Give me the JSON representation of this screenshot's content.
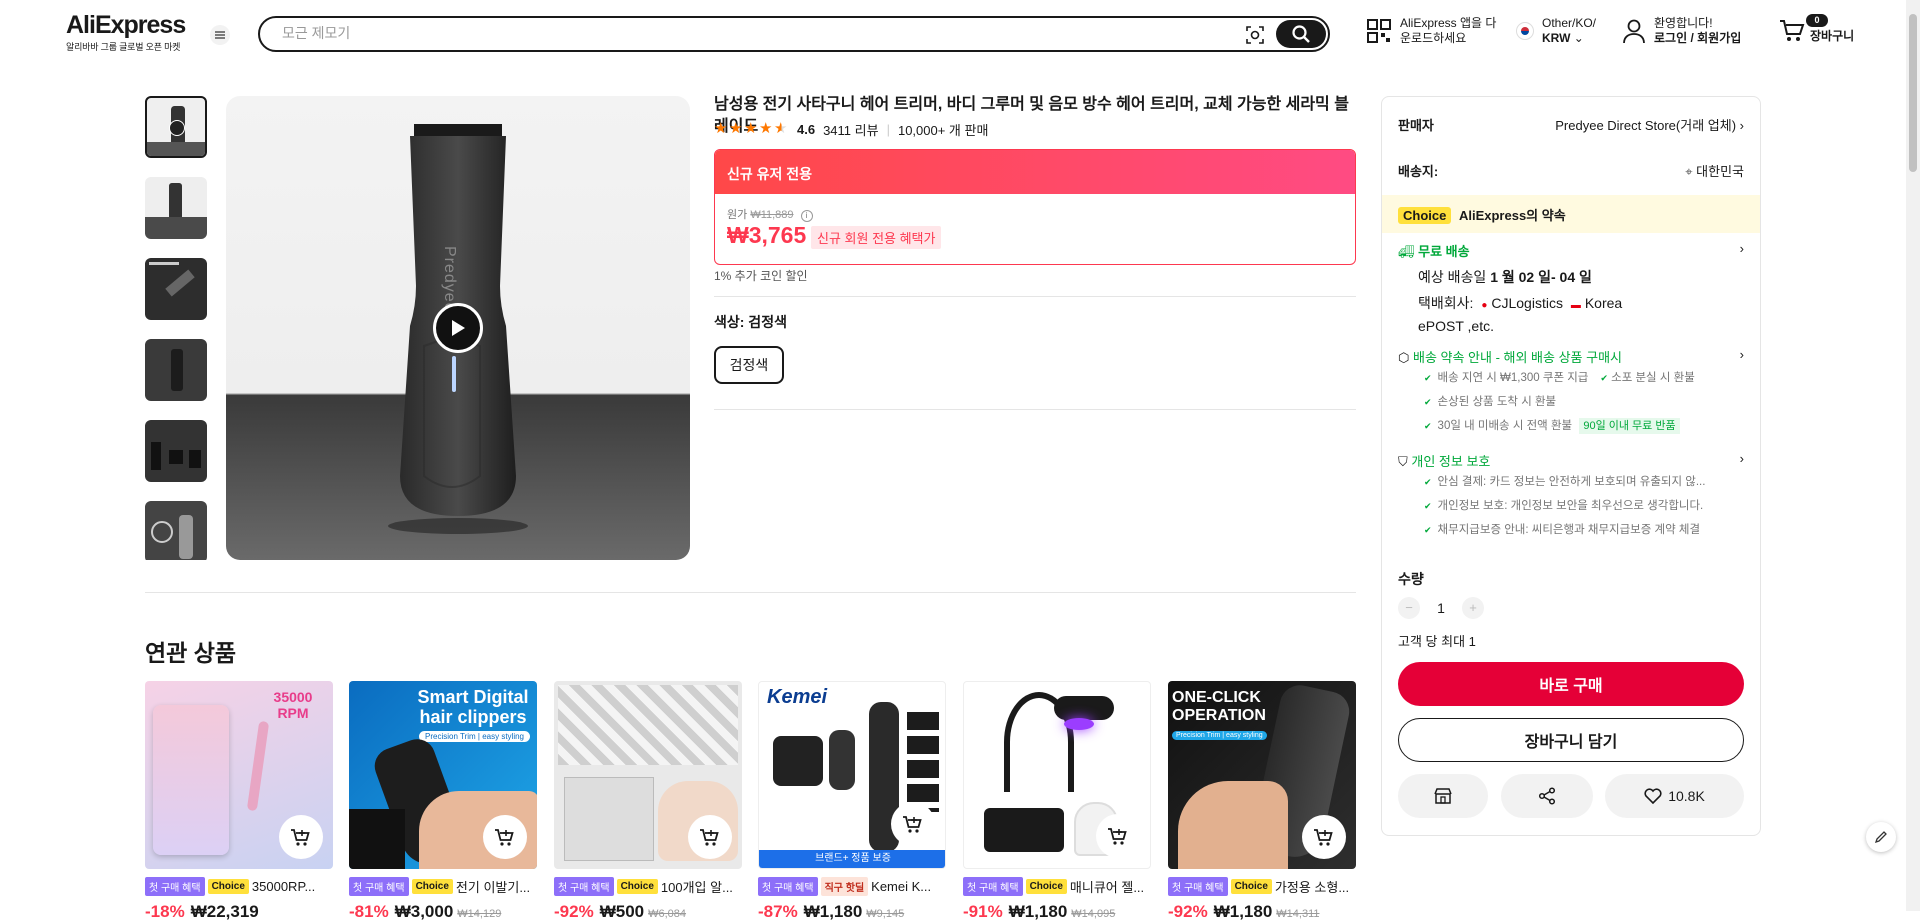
{
  "header": {
    "logo": "AliExpress",
    "logo_sub": "알리바바 그룹 글로벌 오픈 마켓",
    "search_placeholder": "모근 제모기",
    "app_line1": "AliExpress 앱을 다",
    "app_line2": "운로드하세요",
    "region_line1": "Other/KO/",
    "region_line2": "KRW",
    "account_line1": "환영합니다!",
    "account_line2": "로그인 / 회원가입",
    "cart_count": "0",
    "cart_label": "장바구니"
  },
  "product": {
    "title": "남성용 전기 사타구니 헤어 트리머, 바디 그루머 및 음모 방수 헤어 트리머, 교체 가능한 세라믹 블레이드",
    "rating": "4.6",
    "reviews": "3411 리뷰",
    "sold": "10,000+ 개 판매",
    "promo_head": "신규 유저 전용",
    "orig_label": "원가",
    "orig_price": "₩11,889",
    "price": "₩3,765",
    "price_tag": "신규 회원 전용 혜택가",
    "coin_note": "1% 추가 코인 할인",
    "color_label": "색상: 검정색",
    "color_option": "검정색",
    "brand_on_image": "Predyee"
  },
  "panel": {
    "seller_label": "판매자",
    "seller_value": "Predyee Direct Store(거래 업체)",
    "ship_label": "배송지:",
    "ship_value": "대한민국",
    "choice_badge": "Choice",
    "choice_text": "AliExpress의 약속",
    "free_ship": "무료 배송",
    "delivery_label": "예상 배송일",
    "delivery_date": "1 월 02 일- 04 일",
    "courier_label": "택배회사:",
    "courier_1": "CJLogistics",
    "courier_2": "Korea",
    "courier_3": "ePOST ,etc.",
    "promise_title": "배송 약속 안내 - 해외 배송 상품 구매시",
    "promise_1": "배송 지연 시 ₩1,300 쿠폰 지급",
    "promise_2": "소포 분실 시 환불",
    "promise_3": "손상된 상품 도착 시 환불",
    "promise_4": "30일 내 미배송 시 전액 환불",
    "promise_4_tag": "90일 이내 무료 반품",
    "privacy_title": "개인 정보 보호",
    "privacy_1": "안심 결제: 카드 정보는 안전하게 보호되며 유출되지 않...",
    "privacy_2": "개인정보 보호: 개인정보 보안을 최우선으로 생각합니다.",
    "privacy_3": "채무지급보증 안내: 씨티은행과 채무지급보증 계약 체결",
    "qty_label": "수량",
    "qty_value": "1",
    "qty_limit": "고객 당 최대 1",
    "buy_now": "바로 구매",
    "add_cart": "장바구니 담기",
    "wishlist_count": "10.8K"
  },
  "related": {
    "title": "연관 상품",
    "items": [
      {
        "tag1": "첫 구매 혜택",
        "tag2": "Choice",
        "name": "35000RP...",
        "pct": "-18%",
        "price": "₩22,319",
        "orig": "",
        "img_text": "35000 RPM"
      },
      {
        "tag1": "첫 구매 혜택",
        "tag2": "Choice",
        "name": "전기 이발기...",
        "pct": "-81%",
        "price": "₩3,000",
        "orig": "₩14,129",
        "img_text": "Smart Digital hair clippers",
        "img_sub": "Precision Trim | easy styling"
      },
      {
        "tag1": "첫 구매 혜택",
        "tag2": "Choice",
        "name": "100개입 알...",
        "pct": "-92%",
        "price": "₩500",
        "orig": "₩6,084",
        "img_text": ""
      },
      {
        "tag1": "첫 구매 혜택",
        "tag2": "직구 핫딜",
        "name": "Kemei K...",
        "pct": "-87%",
        "price": "₩1,180",
        "orig": "₩9,145",
        "img_text": "Kemei",
        "img_band": "브랜드+ 정품 보증"
      },
      {
        "tag1": "첫 구매 혜택",
        "tag2": "Choice",
        "name": "매니큐어 젤...",
        "pct": "-91%",
        "price": "₩1,180",
        "orig": "₩14,095",
        "img_text": ""
      },
      {
        "tag1": "첫 구매 혜택",
        "tag2": "Choice",
        "name": "가정용 소형...",
        "pct": "-92%",
        "price": "₩1,180",
        "orig": "₩14,311",
        "img_text": "ONE-CLICK OPERATION",
        "img_sub": "Precision Trim | easy styling"
      }
    ]
  }
}
